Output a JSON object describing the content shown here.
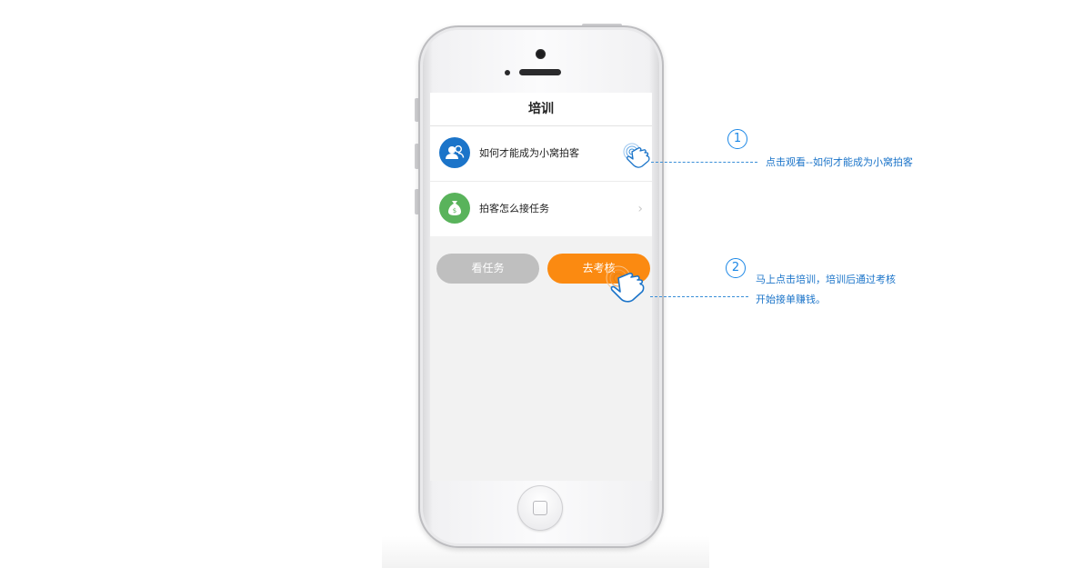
{
  "screen": {
    "title": "培训",
    "items": [
      {
        "label": "如何才能成为小窝拍客",
        "icon": "users-icon",
        "icon_color": "#1b74c9"
      },
      {
        "label": "拍客怎么接任务",
        "icon": "money-bag-icon",
        "icon_color": "#59b35b"
      }
    ],
    "chevron": "›",
    "buttons": {
      "view_tasks": "看任务",
      "go_exam": "去考核"
    },
    "colors": {
      "orange": "#fb8a11",
      "gray": "#bfbfbf"
    }
  },
  "annotations": [
    {
      "number": "1",
      "text": "点击观看--如何才能成为小窝拍客"
    },
    {
      "number": "2",
      "lines": [
        "马上点击培训，培训后通过考核",
        "开始接单赚钱。"
      ]
    }
  ],
  "accent_color": "#1b87e6"
}
